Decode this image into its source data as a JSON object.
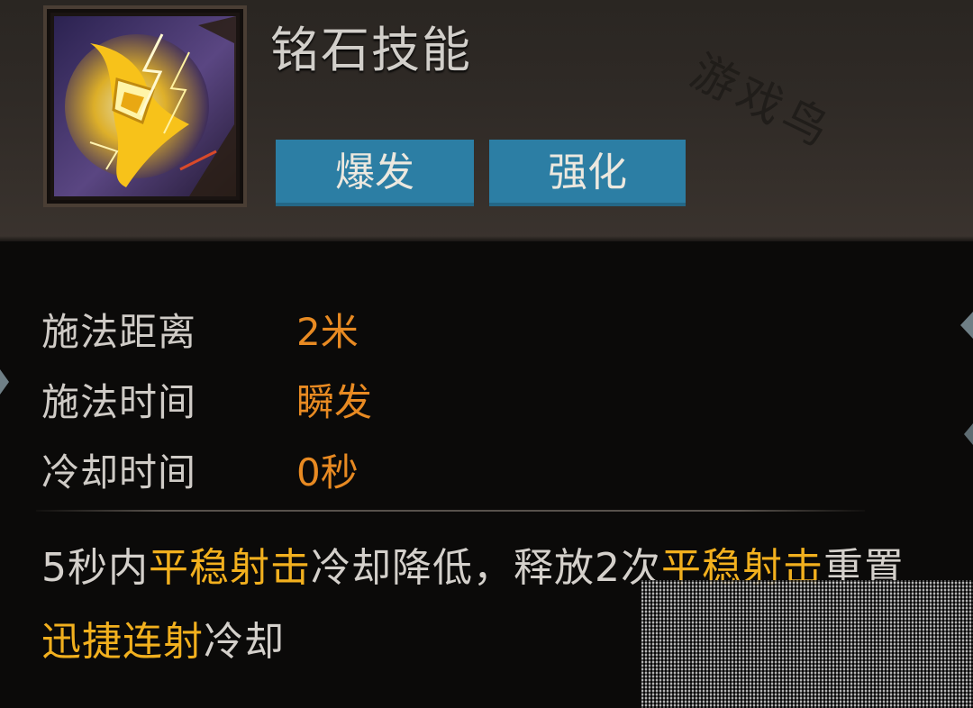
{
  "skill": {
    "title": "铭石技能",
    "icon_name": "crossbow-lightning-icon",
    "tags": [
      "爆发",
      "强化"
    ]
  },
  "watermark": "游戏鸟",
  "stats": [
    {
      "label": "施法距离",
      "value": "2米"
    },
    {
      "label": "施法时间",
      "value": "瞬发"
    },
    {
      "label": "冷却时间",
      "value": "0秒"
    }
  ],
  "description": {
    "segments": [
      {
        "text": "5秒内",
        "highlight": false
      },
      {
        "text": "平稳射击",
        "highlight": true
      },
      {
        "text": "冷却降低，释放2次",
        "highlight": false
      },
      {
        "text": "平稳射击",
        "highlight": true
      },
      {
        "text": "重置",
        "highlight": false
      },
      {
        "text": "迅捷连射",
        "highlight": true
      },
      {
        "text": "冷却",
        "highlight": false
      }
    ]
  },
  "colors": {
    "tag_bg": "#2c7ea4",
    "stat_value": "#e88a22",
    "highlight": "#f2b01e"
  }
}
